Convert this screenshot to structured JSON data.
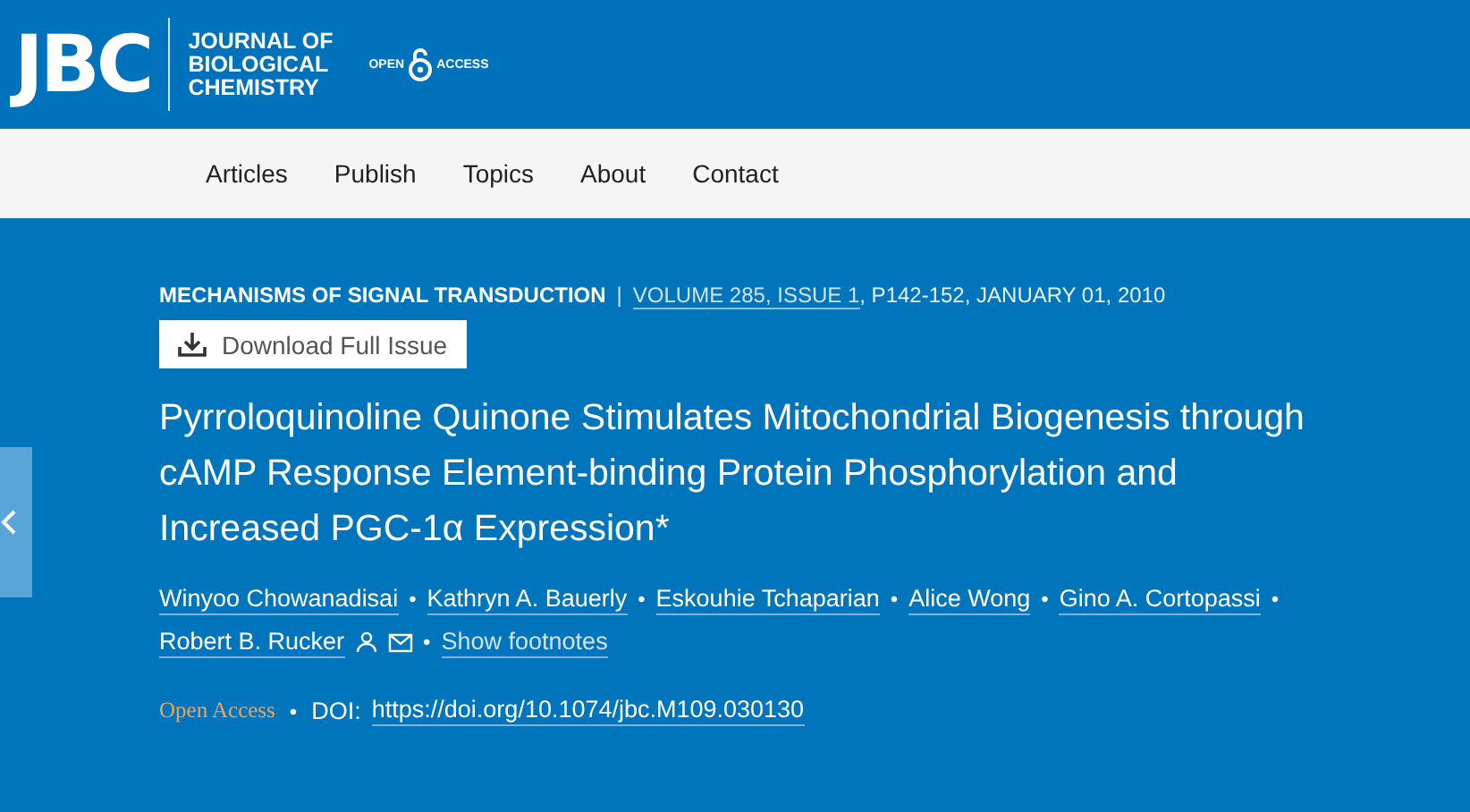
{
  "header": {
    "logo": "JBC",
    "journal_lines": [
      "JOURNAL OF",
      "BIOLOGICAL",
      "CHEMISTRY"
    ],
    "open_access_left": "OPEN",
    "open_access_right": "ACCESS"
  },
  "nav": {
    "items": [
      "Articles",
      "Publish",
      "Topics",
      "About",
      "Contact"
    ]
  },
  "article": {
    "section": "MECHANISMS OF SIGNAL TRANSDUCTION",
    "separator": "|",
    "issue_link": "VOLUME 285, ISSUE 1",
    "citation": ", P142-152, JANUARY 01, 2010",
    "download_button": "Download Full Issue",
    "title": "Pyrroloquinoline Quinone Stimulates Mitochondrial Biogenesis through cAMP Response Element-binding Protein Phosphorylation and Increased PGC-1α Expression*",
    "authors": [
      {
        "name": "Winyoo Chowanadisai",
        "corresponding": false
      },
      {
        "name": "Kathryn A. Bauerly",
        "corresponding": false
      },
      {
        "name": "Eskouhie Tchaparian",
        "corresponding": false
      },
      {
        "name": "Alice Wong",
        "corresponding": false
      },
      {
        "name": "Gino A. Cortopassi",
        "corresponding": false
      },
      {
        "name": "Robert B. Rucker",
        "corresponding": true
      }
    ],
    "bullet": "•",
    "footnotes_link": "Show footnotes",
    "access": "Open Access",
    "doi_label": "DOI:",
    "doi": "https://doi.org/10.1074/jbc.M109.030130"
  }
}
